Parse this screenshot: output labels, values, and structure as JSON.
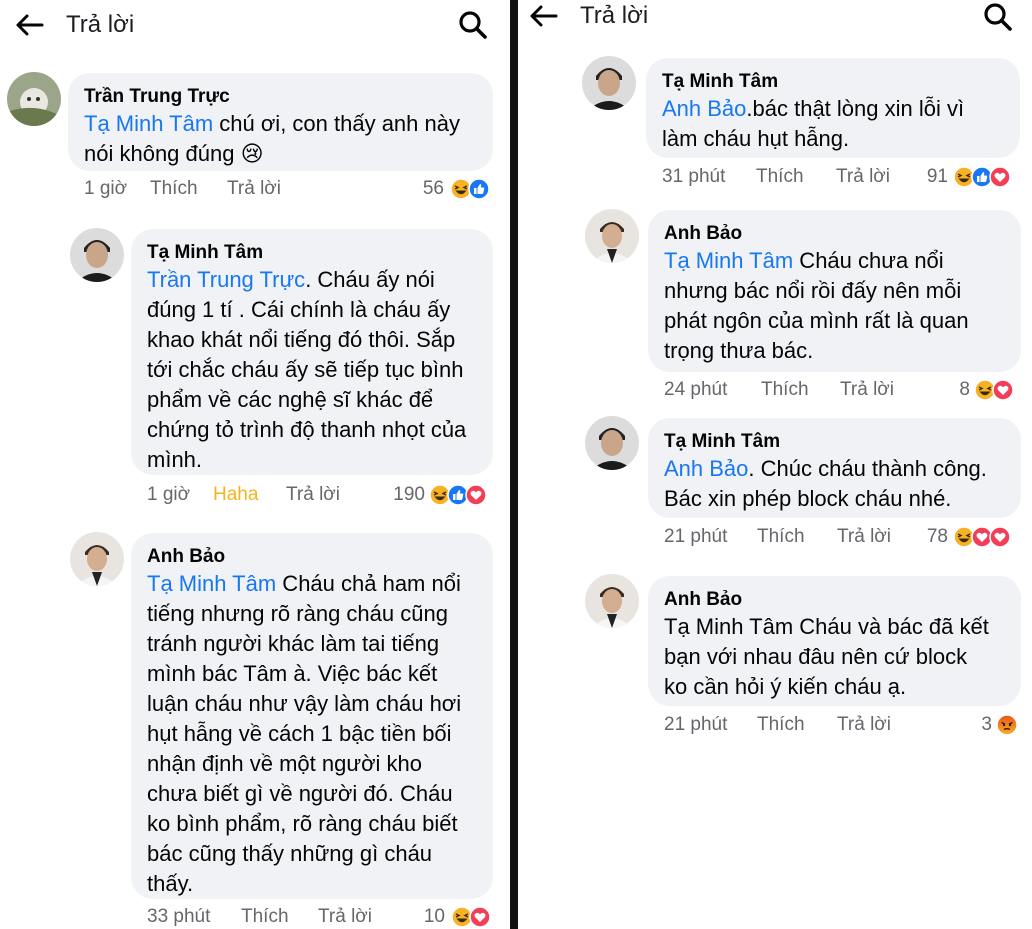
{
  "header": {
    "back_icon": "arrow-left-icon",
    "title": "Trả lời",
    "search_icon": "search-icon"
  },
  "colors": {
    "mention": "#1877f2",
    "bubble": "#f0f2f5",
    "meta": "#65676b",
    "haha": "#f2b51b"
  },
  "left_comments": [
    {
      "author": "Trần Trung Trực",
      "mention": "Tạ Minh Tâm",
      "lines": [
        "  chú ơi, con thấy anh này",
        "nói không đúng 😢"
      ],
      "time": "1 giờ",
      "like": "Thích",
      "reply": "Trả lời",
      "count": "56",
      "reactions": [
        "haha",
        "like"
      ]
    },
    {
      "author": "Tạ Minh Tâm",
      "mention": "Trần Trung Trực",
      "lines": [
        ". Cháu ấy nói",
        "đúng 1 tí . Cái chính là cháu ấy",
        "khao khát nổi tiếng đó thôi. Sắp",
        "tới chắc cháu ấy sẽ tiếp tục bình",
        "phẩm về các nghệ sĩ khác để",
        "chứng tỏ trình độ thanh nhọt của",
        "mình."
      ],
      "time": "1 giờ",
      "like": "Haha",
      "reply": "Trả lời",
      "count": "190",
      "reactions": [
        "haha",
        "like",
        "love"
      ]
    },
    {
      "author": "Anh Bảo",
      "mention": "Tạ Minh Tâm",
      "lines": [
        " Cháu chả ham nổi",
        "tiếng nhưng rõ ràng cháu cũng",
        "tránh người khác làm tai tiếng",
        "mình bác Tâm à. Việc bác kết",
        "luận cháu như vậy làm cháu hơi",
        "hụt hẫng về cách 1 bậc tiền bối",
        "nhận định về một người kho",
        "chưa biết gì về người đó. Cháu",
        "ko bình phẩm, rõ ràng cháu biết",
        "bác cũng thấy những gì cháu",
        "thấy."
      ],
      "time": "33 phút",
      "like": "Thích",
      "reply": "Trả lời",
      "count": "10",
      "reactions": [
        "haha",
        "love"
      ]
    }
  ],
  "right_comments": [
    {
      "author": "Tạ Minh Tâm",
      "mention": "Anh Bảo",
      "lines": [
        ".bác thật lòng xin lỗi vì",
        "làm cháu hụt hẫng."
      ],
      "time": "31 phút",
      "like": "Thích",
      "reply": "Trả lời",
      "count": "91",
      "reactions": [
        "haha",
        "like",
        "love"
      ]
    },
    {
      "author": "Anh Bảo",
      "mention": "Tạ Minh Tâm",
      "lines": [
        " Cháu chưa nổi",
        "nhưng bác nổi rồi đấy nên mỗi",
        "phát ngôn của mình rất là quan",
        "trọng thưa bác."
      ],
      "time": "24 phút",
      "like": "Thích",
      "reply": "Trả lời",
      "count": "8",
      "reactions": [
        "haha",
        "love"
      ]
    },
    {
      "author": "Tạ Minh Tâm",
      "mention": "Anh Bảo",
      "lines": [
        ". Chúc cháu thành công.",
        "Bác xin phép block cháu nhé."
      ],
      "time": "21 phút",
      "like": "Thích",
      "reply": "Trả lời",
      "count": "78",
      "reactions": [
        "haha",
        "love",
        "love"
      ]
    },
    {
      "author": "Anh Bảo",
      "mention": "",
      "lines": [
        "Tạ Minh Tâm Cháu và bác đã kết",
        "bạn với nhau đâu nên cứ block",
        "ko cần hỏi ý kiến cháu ạ."
      ],
      "time": "21 phút",
      "like": "Thích",
      "reply": "Trả lời",
      "count": "3",
      "reactions": [
        "angry"
      ]
    }
  ]
}
